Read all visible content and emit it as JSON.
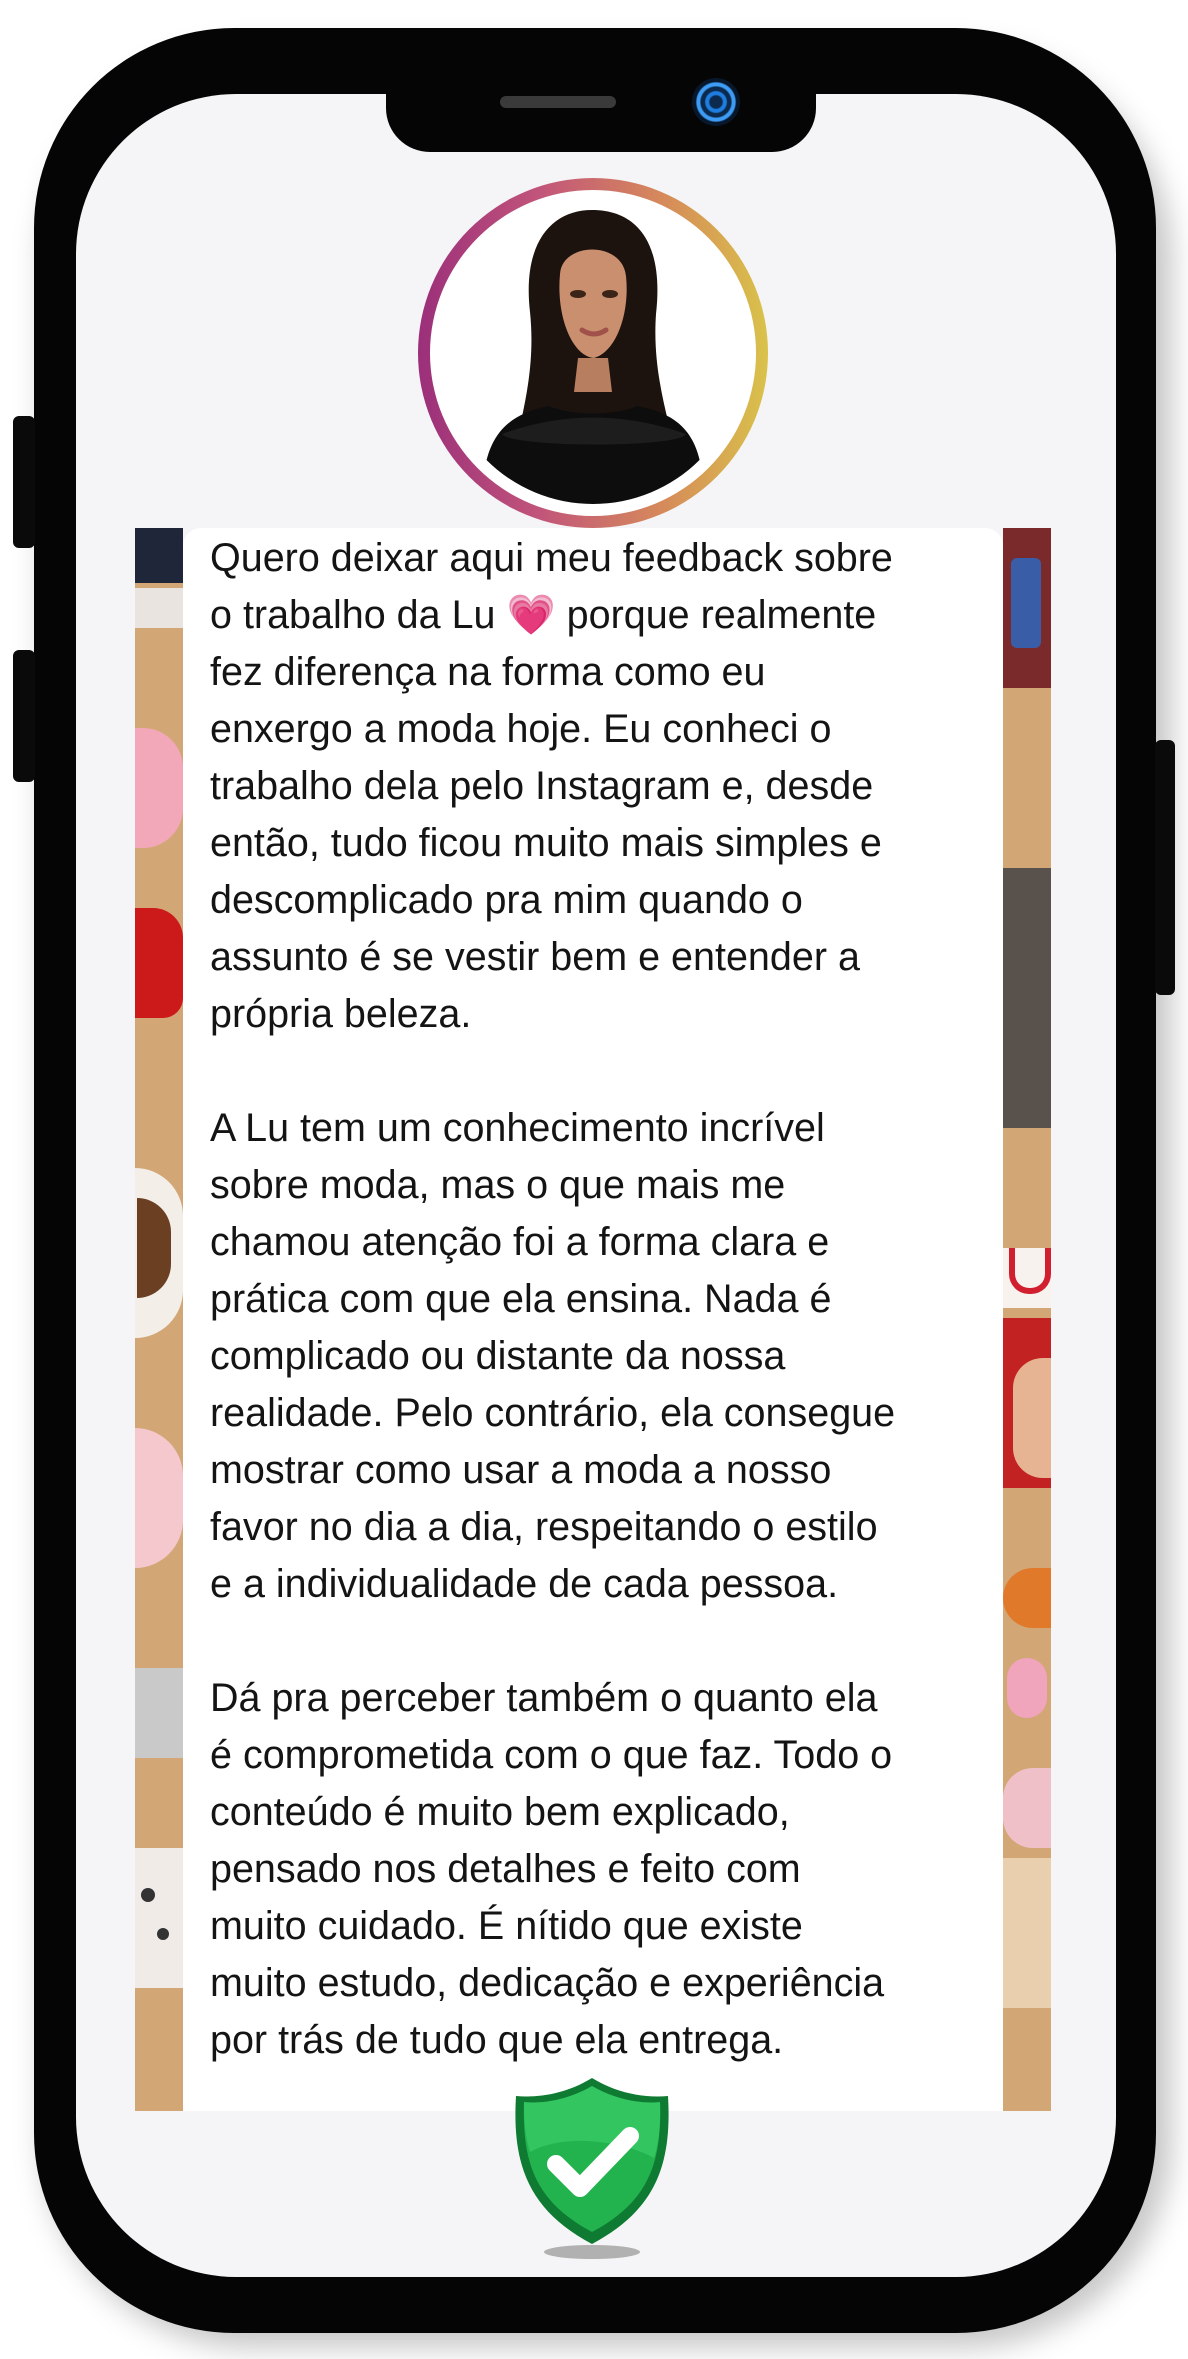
{
  "profile": {
    "avatar_alt": "profile-photo",
    "ring_gradient": [
      "#9b2f7a",
      "#c2557a",
      "#d68a5a",
      "#d9c24a"
    ]
  },
  "review": {
    "paragraph_1": {
      "before_emoji": "Quero deixar aqui meu feedback sobre\no trabalho da Lu ",
      "emoji": "💗",
      "after_emoji": " porque realmente\nfez diferença na forma como eu\nenxergo a moda hoje. Eu conheci o\ntrabalho dela pelo Instagram e, desde\nentão, tudo ficou muito mais simples e\ndescomplicado pra mim quando o\nassunto é se vestir bem e entender a\nprópria beleza."
    },
    "paragraph_2": "A Lu tem um conhecimento incrível\nsobre moda, mas o que mais me\nchamou atenção foi a forma clara e\nprática com que ela ensina. Nada é\ncomplicado ou distante da nossa\nrealidade. Pelo contrário, ela consegue\nmostrar como usar a moda a nosso\nfavor no dia a dia, respeitando o estilo\ne a individualidade de cada pessoa.",
    "paragraph_3": "Dá pra perceber também o quanto ela\né comprometida com o que faz. Todo o\nconteúdo é muito bem explicado,\npensado nos detalhes e feito com\nmuito cuidado. É nítido que existe\nmuito estudo, dedicação e experiência\npor trás de tudo que ela entrega."
  },
  "badge": {
    "icon": "verified-check-shield-icon",
    "color": "#1faa4a"
  },
  "colors": {
    "phone_frame": "#050505",
    "screen_background": "#f5f5f7",
    "camera_accent": "#1e7de0"
  }
}
